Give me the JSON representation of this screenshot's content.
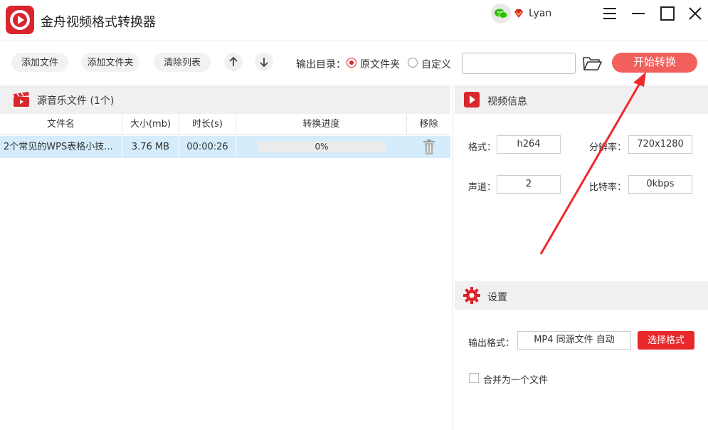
{
  "app": {
    "title": "金舟视频格式转换器",
    "user": "Lyan",
    "brand_color": "#d9262c"
  },
  "toolbar": {
    "add_file": "添加文件",
    "add_folder": "添加文件夹",
    "clear_list": "清除列表",
    "output_label": "输出目录：",
    "radio_original": "原文件夹",
    "radio_custom": "自定义",
    "selected_output": "原文件夹",
    "path_value": "",
    "start_label": "开始转换",
    "start_color": "#f25f5c"
  },
  "file_panel": {
    "title": "源音乐文件 (1个)",
    "columns": [
      "文件名",
      "大小(mb)",
      "时长(s)",
      "转换进度",
      "移除"
    ],
    "rows": [
      {
        "name": "2个常见的WPS表格小技...",
        "size": "3.76 MB",
        "duration": "00:00:26",
        "progress_text": "0%",
        "progress": 0
      }
    ],
    "selected_row_color": "#d4ecfb"
  },
  "video_info": {
    "title": "视频信息",
    "format_label": "格式：",
    "format_value": "h264",
    "resolution_label": "分辨率：",
    "resolution_value": "720x1280",
    "channel_label": "声道：",
    "channel_value": "2",
    "bitrate_label": "比特率：",
    "bitrate_value": "0kbps"
  },
  "settings": {
    "title": "设置",
    "output_format_label": "输出格式：",
    "output_format_value": "MP4 同源文件 自动",
    "choose_format": "选择格式",
    "merge_label": "合并为一个文件",
    "merge_checked": false
  },
  "icons": {
    "logo": "app-logo-icon",
    "wechat": "wechat-icon",
    "vip": "vip-diamond-icon",
    "minimize": "minimize-icon",
    "maximize": "maximize-icon",
    "close": "close-icon",
    "menu": "menu-icon",
    "up": "arrow-up-icon",
    "down": "arrow-down-icon",
    "folder": "folder-open-icon",
    "music": "clapper-icon",
    "trash": "trash-icon",
    "video": "play-icon",
    "settings": "gear-icon"
  }
}
